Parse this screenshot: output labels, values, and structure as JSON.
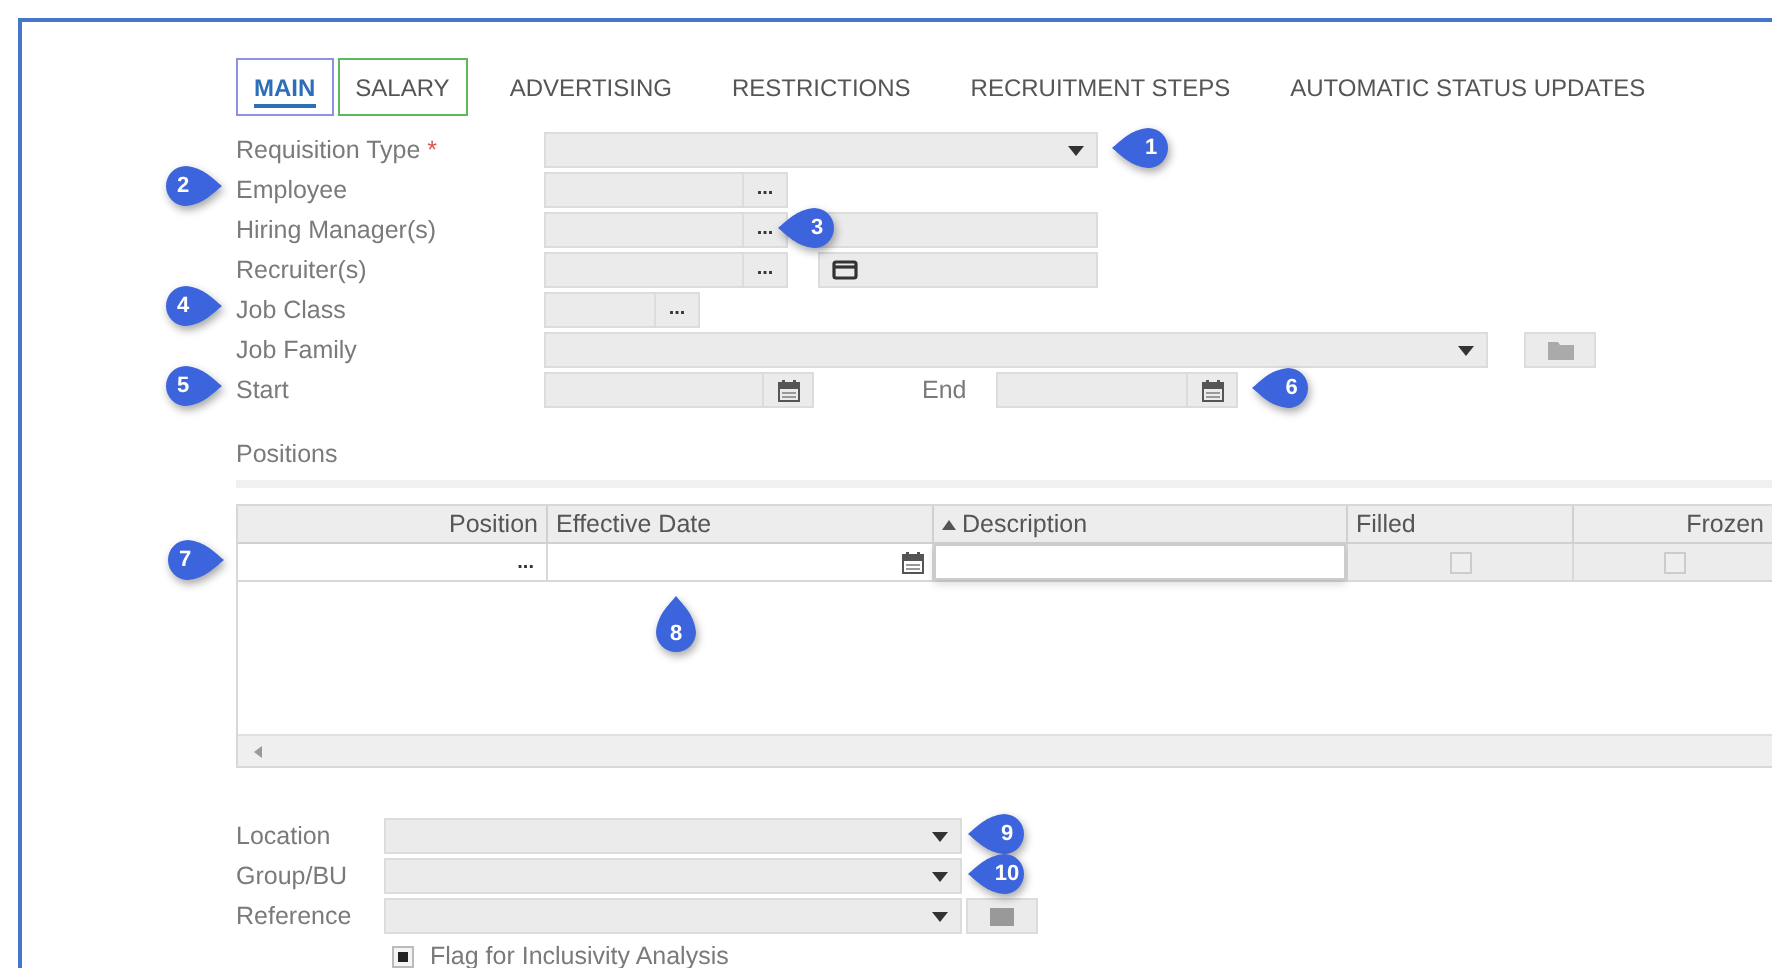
{
  "tabs": [
    {
      "label": "MAIN",
      "selected": true,
      "color": "#8f91e3"
    },
    {
      "label": "SALARY",
      "selected": false,
      "color": "#5cb85c"
    },
    {
      "label": "ADVERTISING",
      "selected": false
    },
    {
      "label": "RESTRICTIONS",
      "selected": false
    },
    {
      "label": "RECRUITMENT STEPS",
      "selected": false
    },
    {
      "label": "AUTOMATIC STATUS UPDATES",
      "selected": false
    }
  ],
  "form": {
    "rows": [
      {
        "kind": "select",
        "label": "Requisition Type",
        "required_mark": "*",
        "callout": {
          "number": "1",
          "kind": "right"
        }
      },
      {
        "kind": "lookup",
        "label": "Employee",
        "button": "...",
        "callout": {
          "number": "2",
          "kind": "left"
        }
      },
      {
        "kind": "lookup-pair",
        "label": "Hiring Manager(s)",
        "button": "...",
        "extra_icon": false,
        "callout": {
          "number": "3",
          "kind": "right"
        }
      },
      {
        "kind": "lookup-pair",
        "label": "Recruiter(s)",
        "button": "...",
        "extra_icon": true
      },
      {
        "kind": "lookup-short",
        "label": "Job Class",
        "button": "...",
        "callout": {
          "number": "4",
          "kind": "left"
        }
      },
      {
        "kind": "select-wide",
        "label": "Job Family"
      },
      {
        "kind": "date-range",
        "label": "Start",
        "end_label": "End",
        "callout": {
          "number": "5",
          "kind": "left"
        },
        "end_callout": {
          "number": "6",
          "kind": "right"
        }
      }
    ]
  },
  "positions": {
    "title": "Positions",
    "columns": [
      {
        "label": "Position",
        "right_aligned": true,
        "sorted_ascending": false
      },
      {
        "label": "Effective Date",
        "right_aligned": false,
        "sorted_ascending": false
      },
      {
        "label": "Description",
        "right_aligned": false,
        "sorted_ascending": true
      },
      {
        "label": "Filled",
        "right_aligned": false,
        "sorted_ascending": false
      },
      {
        "label": "Frozen",
        "right_aligned": true,
        "sorted_ascending": false
      }
    ],
    "row": {
      "callout": {
        "number": "7",
        "kind": "left"
      },
      "cells": [
        {
          "kind": "lookup",
          "button": "..."
        },
        {
          "kind": "date",
          "callout": {
            "number": "8",
            "kind": "below"
          }
        },
        {
          "kind": "text"
        },
        {
          "kind": "checkbox",
          "checked": false
        },
        {
          "kind": "checkbox",
          "checked": false
        }
      ]
    }
  },
  "lower": {
    "rows": [
      {
        "kind": "select",
        "label": "Location",
        "callout": {
          "number": "9",
          "kind": "right"
        }
      },
      {
        "kind": "select",
        "label": "Group/BU",
        "callout": {
          "number": "10",
          "kind": "right"
        }
      },
      {
        "kind": "select-button",
        "label": "Reference"
      }
    ],
    "flag": {
      "label": "Flag for Inclusivity Analysis",
      "checked": true
    }
  }
}
